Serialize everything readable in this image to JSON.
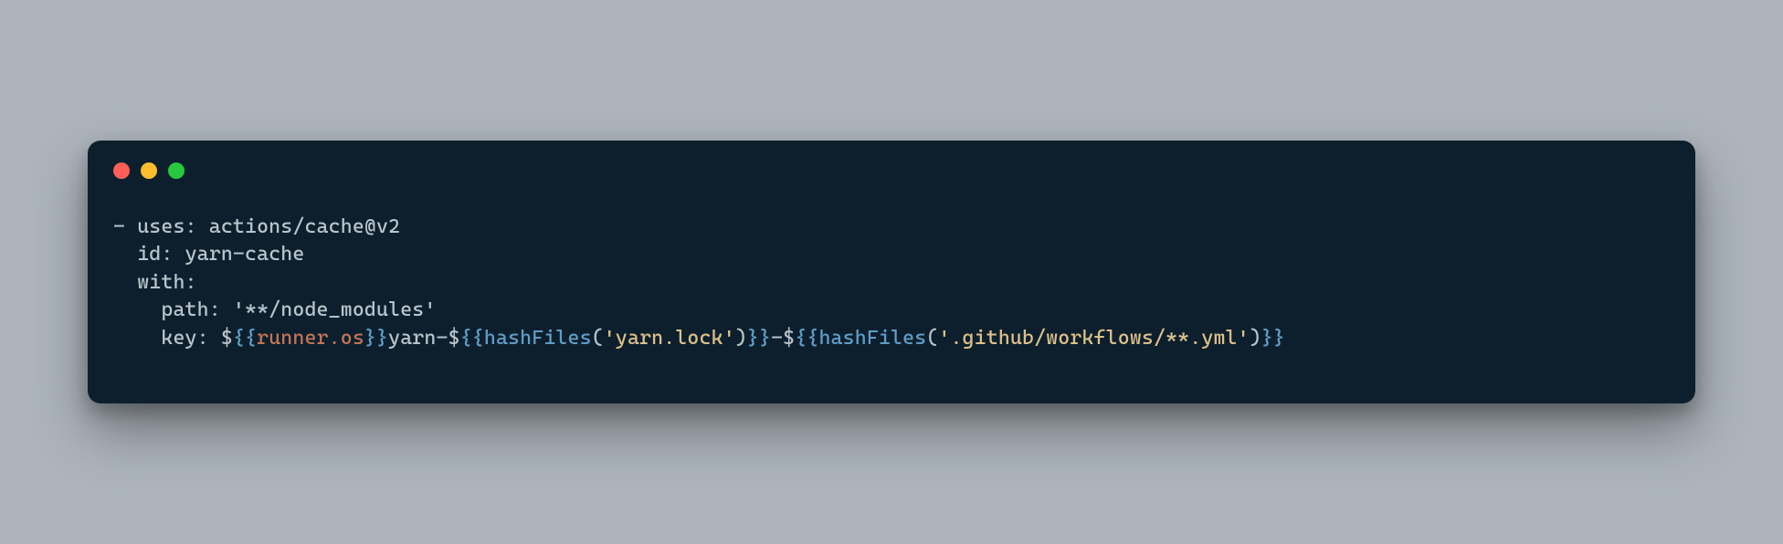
{
  "code": {
    "line1": {
      "prefix": "- ",
      "key": "uses:",
      "sp": " ",
      "val": "actions/cache@v2"
    },
    "line2": {
      "indent": "  ",
      "key": "id:",
      "sp": " ",
      "val": "yarn-cache"
    },
    "line3": {
      "indent": "  ",
      "key": "with:"
    },
    "line4": {
      "indent": "    ",
      "key": "path:",
      "sp": " ",
      "val": "'**/node_modules'"
    },
    "line5": {
      "indent": "    ",
      "key": "key:",
      "sp": " ",
      "dollar1": "$",
      "brace_open1": "{{",
      "var1": "runner.os",
      "brace_close1": "}}",
      "text1": "yarn-",
      "dollar2": "$",
      "brace_open2": "{{",
      "func1": "hashFiles",
      "paren_open1": "(",
      "str1": "'yarn.lock'",
      "paren_close1": ")",
      "brace_close2": "}}",
      "text2": "-",
      "dollar3": "$",
      "brace_open3": "{{",
      "func2": "hashFiles",
      "paren_open2": "(",
      "str2": "'.github/workflows/**.yml'",
      "paren_close2": ")",
      "brace_close3": "}}"
    }
  }
}
